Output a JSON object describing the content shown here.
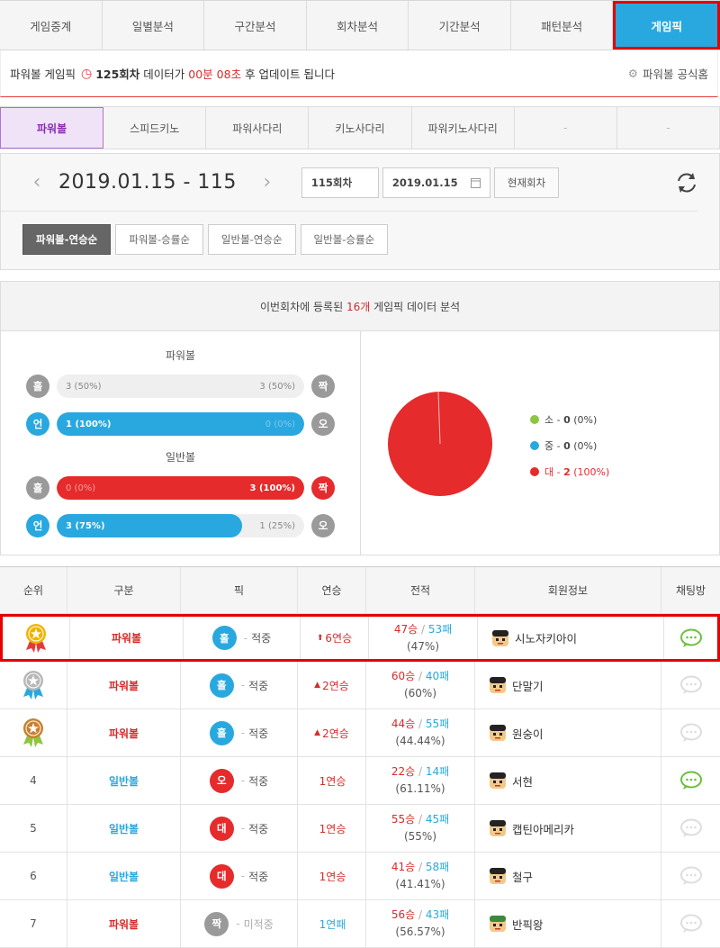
{
  "top_tabs": [
    "게임중계",
    "일별분석",
    "구간분석",
    "회차분석",
    "기간분석",
    "패턴분석",
    "게임픽"
  ],
  "notice": {
    "prefix": "파워볼 게임픽",
    "round": "125회차",
    "mid": "데이터가",
    "time": "00분 08초",
    "suffix": "후 업데이트 됩니다",
    "link": "파워볼 공식홈"
  },
  "sub_tabs": [
    "파워볼",
    "스피드키노",
    "파워사다리",
    "키노사다리",
    "파워키노사다리",
    "-",
    "-"
  ],
  "date": {
    "title": "2019.01.15 - 115",
    "round_input": "115회차",
    "date_input": "2019.01.15",
    "current_button": "현재회차"
  },
  "sort_buttons": [
    "파워볼-연승순",
    "파워볼-승률순",
    "일반볼-연승순",
    "일반볼-승률순"
  ],
  "analysis": {
    "head_pre": "이번회차에 등록된",
    "count": "16개",
    "head_post": "게임픽 데이터 분석",
    "powerball_title": "파워볼",
    "normal_title": "일반볼",
    "pb_oe": {
      "left": "홀",
      "right": "짝",
      "left_text": "3 (50%)",
      "right_text": "3 (50%)",
      "left_ratio": 0.5,
      "color": "#efefef"
    },
    "pb_uo": {
      "left": "언",
      "right": "오",
      "left_text": "1 (100%)",
      "right_text": "0 (0%)",
      "left_ratio": 1.0,
      "color": "#29a8df"
    },
    "nb_oe": {
      "left": "홀",
      "right": "짝",
      "left_text": "0 (0%)",
      "right_text": "3 (100%)",
      "left_ratio": 1.0,
      "color": "#e52b2b"
    },
    "nb_uo": {
      "left": "언",
      "right": "오",
      "left_text": "3 (75%)",
      "right_text": "1 (25%)",
      "left_ratio": 0.75,
      "color": "#29a8df"
    },
    "legend": [
      {
        "label": "소",
        "value": "0",
        "pct": "(0%)",
        "color": "#8cc63f"
      },
      {
        "label": "중",
        "value": "0",
        "pct": "(0%)",
        "color": "#29a8df"
      },
      {
        "label": "대",
        "value": "2",
        "pct": "(100%)",
        "color": "#e52b2b"
      }
    ]
  },
  "table": {
    "headers": [
      "순위",
      "구분",
      "픽",
      "연승",
      "전적",
      "회원정보",
      "채팅방"
    ],
    "rows": [
      {
        "rank": "1",
        "kind": "파워볼",
        "pick": "홀",
        "pick_result": "적중",
        "streak": "6연승",
        "win": "47승",
        "lose": "53패",
        "rate": "(47%)",
        "user": "시노자키아이"
      },
      {
        "rank": "2",
        "kind": "파워볼",
        "pick": "홀",
        "pick_result": "적중",
        "streak": "2연승",
        "win": "60승",
        "lose": "40패",
        "rate": "(60%)",
        "user": "단말기"
      },
      {
        "rank": "3",
        "kind": "파워볼",
        "pick": "홀",
        "pick_result": "적중",
        "streak": "2연승",
        "win": "44승",
        "lose": "55패",
        "rate": "(44.44%)",
        "user": "원숭이"
      },
      {
        "rank": "4",
        "kind": "일반볼",
        "pick": "오",
        "pick_result": "적중",
        "streak": "1연승",
        "win": "22승",
        "lose": "14패",
        "rate": "(61.11%)",
        "user": "서현"
      },
      {
        "rank": "5",
        "kind": "일반볼",
        "pick": "대",
        "pick_result": "적중",
        "streak": "1연승",
        "win": "55승",
        "lose": "45패",
        "rate": "(55%)",
        "user": "캡틴아메리카"
      },
      {
        "rank": "6",
        "kind": "일반볼",
        "pick": "대",
        "pick_result": "적중",
        "streak": "1연승",
        "win": "41승",
        "lose": "58패",
        "rate": "(41.41%)",
        "user": "철구"
      },
      {
        "rank": "7",
        "kind": "파워볼",
        "pick": "짝",
        "pick_result": "미적중",
        "streak": "1연패",
        "win": "56승",
        "lose": "43패",
        "rate": "(56.57%)",
        "user": "반픽왕"
      }
    ]
  }
}
